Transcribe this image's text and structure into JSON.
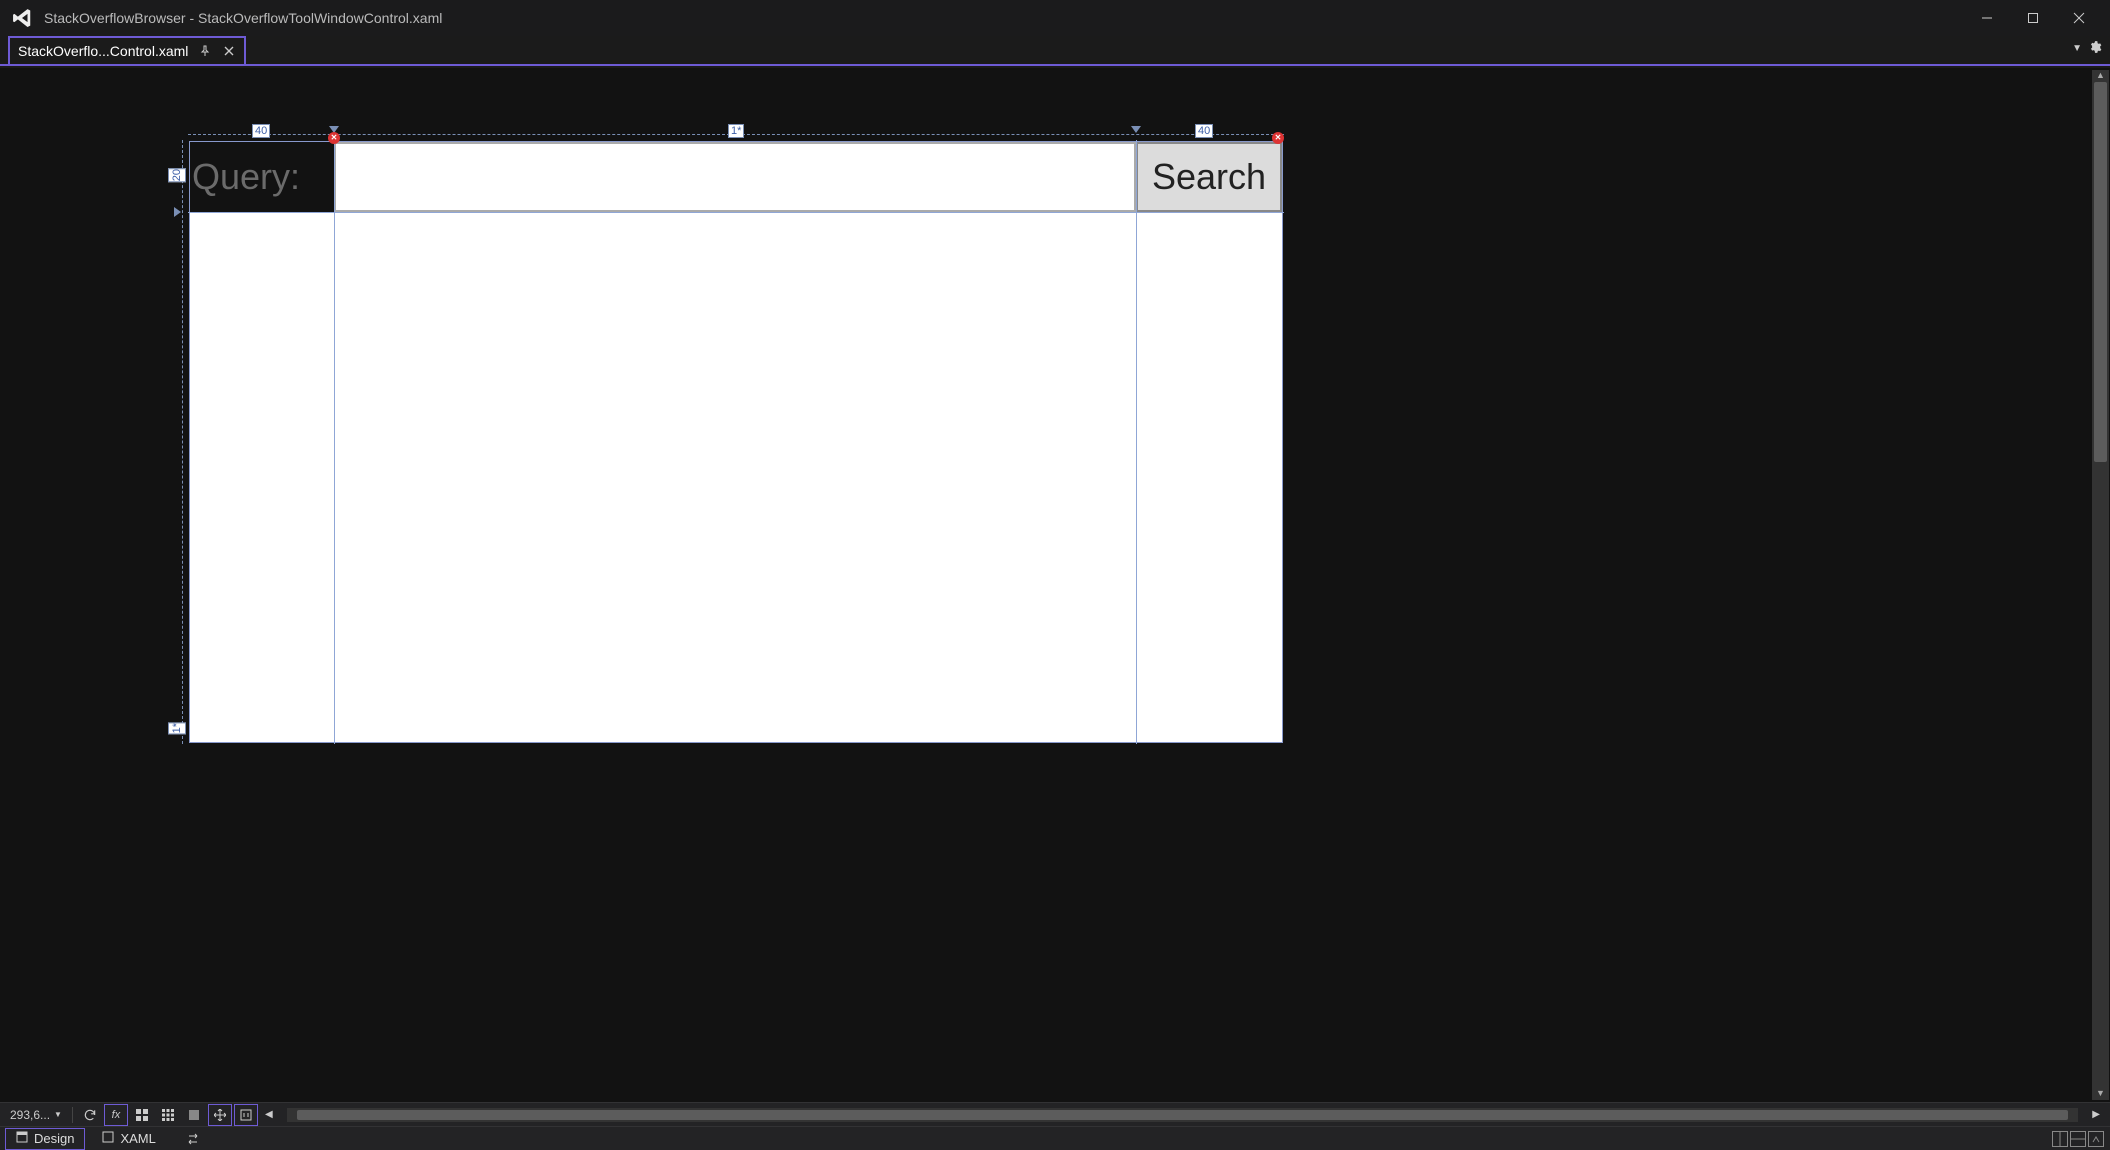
{
  "window": {
    "title": "StackOverflowBrowser - StackOverflowToolWindowControl.xaml"
  },
  "tab": {
    "label": "StackOverflo...Control.xaml"
  },
  "designer": {
    "columns": {
      "c0": "40",
      "c1": "1*",
      "c2": "40"
    },
    "rows": {
      "r0": "20",
      "r1": "1*"
    },
    "query_label": "Query:",
    "search_button": "Search",
    "textbox_value": ""
  },
  "toolbar": {
    "zoom": "293,6..."
  },
  "status": {
    "design_tab": "Design",
    "xaml_tab": "XAML"
  }
}
